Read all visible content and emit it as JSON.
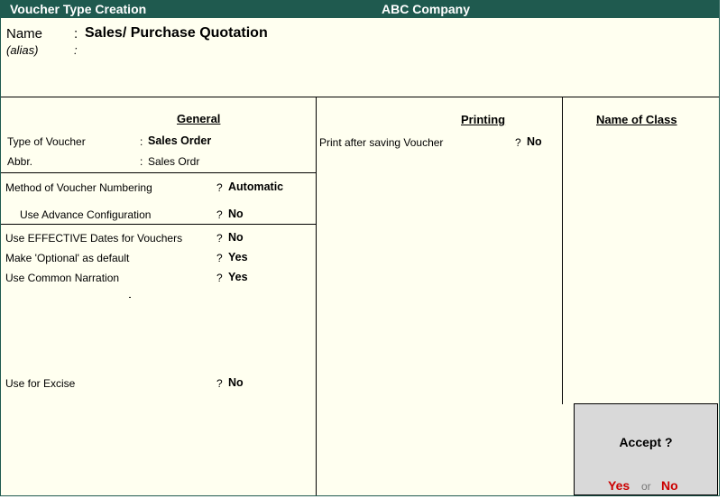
{
  "titlebar": {
    "screen_title": "Voucher Type Creation",
    "company": "ABC Company"
  },
  "header": {
    "name_label": "Name",
    "name_value": "Sales/ Purchase Quotation",
    "alias_label": "(alias)",
    "sep": ":"
  },
  "general": {
    "heading": "General",
    "type_of_voucher_label": "Type of Voucher",
    "type_of_voucher_value": "Sales Order",
    "abbr_label": "Abbr.",
    "abbr_value": "Sales Ordr",
    "numbering_label": "Method of Voucher Numbering",
    "numbering_value": "Automatic",
    "advance_label": "Use Advance Configuration",
    "advance_value": "No",
    "effective_label": "Use EFFECTIVE Dates for Vouchers",
    "effective_value": "No",
    "optional_label": "Make 'Optional' as default",
    "optional_value": "Yes",
    "narration_label": "Use Common Narration",
    "narration_value": "Yes",
    "excise_label": "Use for Excise",
    "excise_value": "No",
    "colon": ":",
    "q": "?"
  },
  "printing": {
    "heading": "Printing",
    "print_after_label": "Print after saving Voucher",
    "print_after_value": "No"
  },
  "class": {
    "heading": "Name of Class"
  },
  "accept": {
    "question": "Accept ?",
    "yes": "Yes",
    "or": "or",
    "no": "No"
  }
}
